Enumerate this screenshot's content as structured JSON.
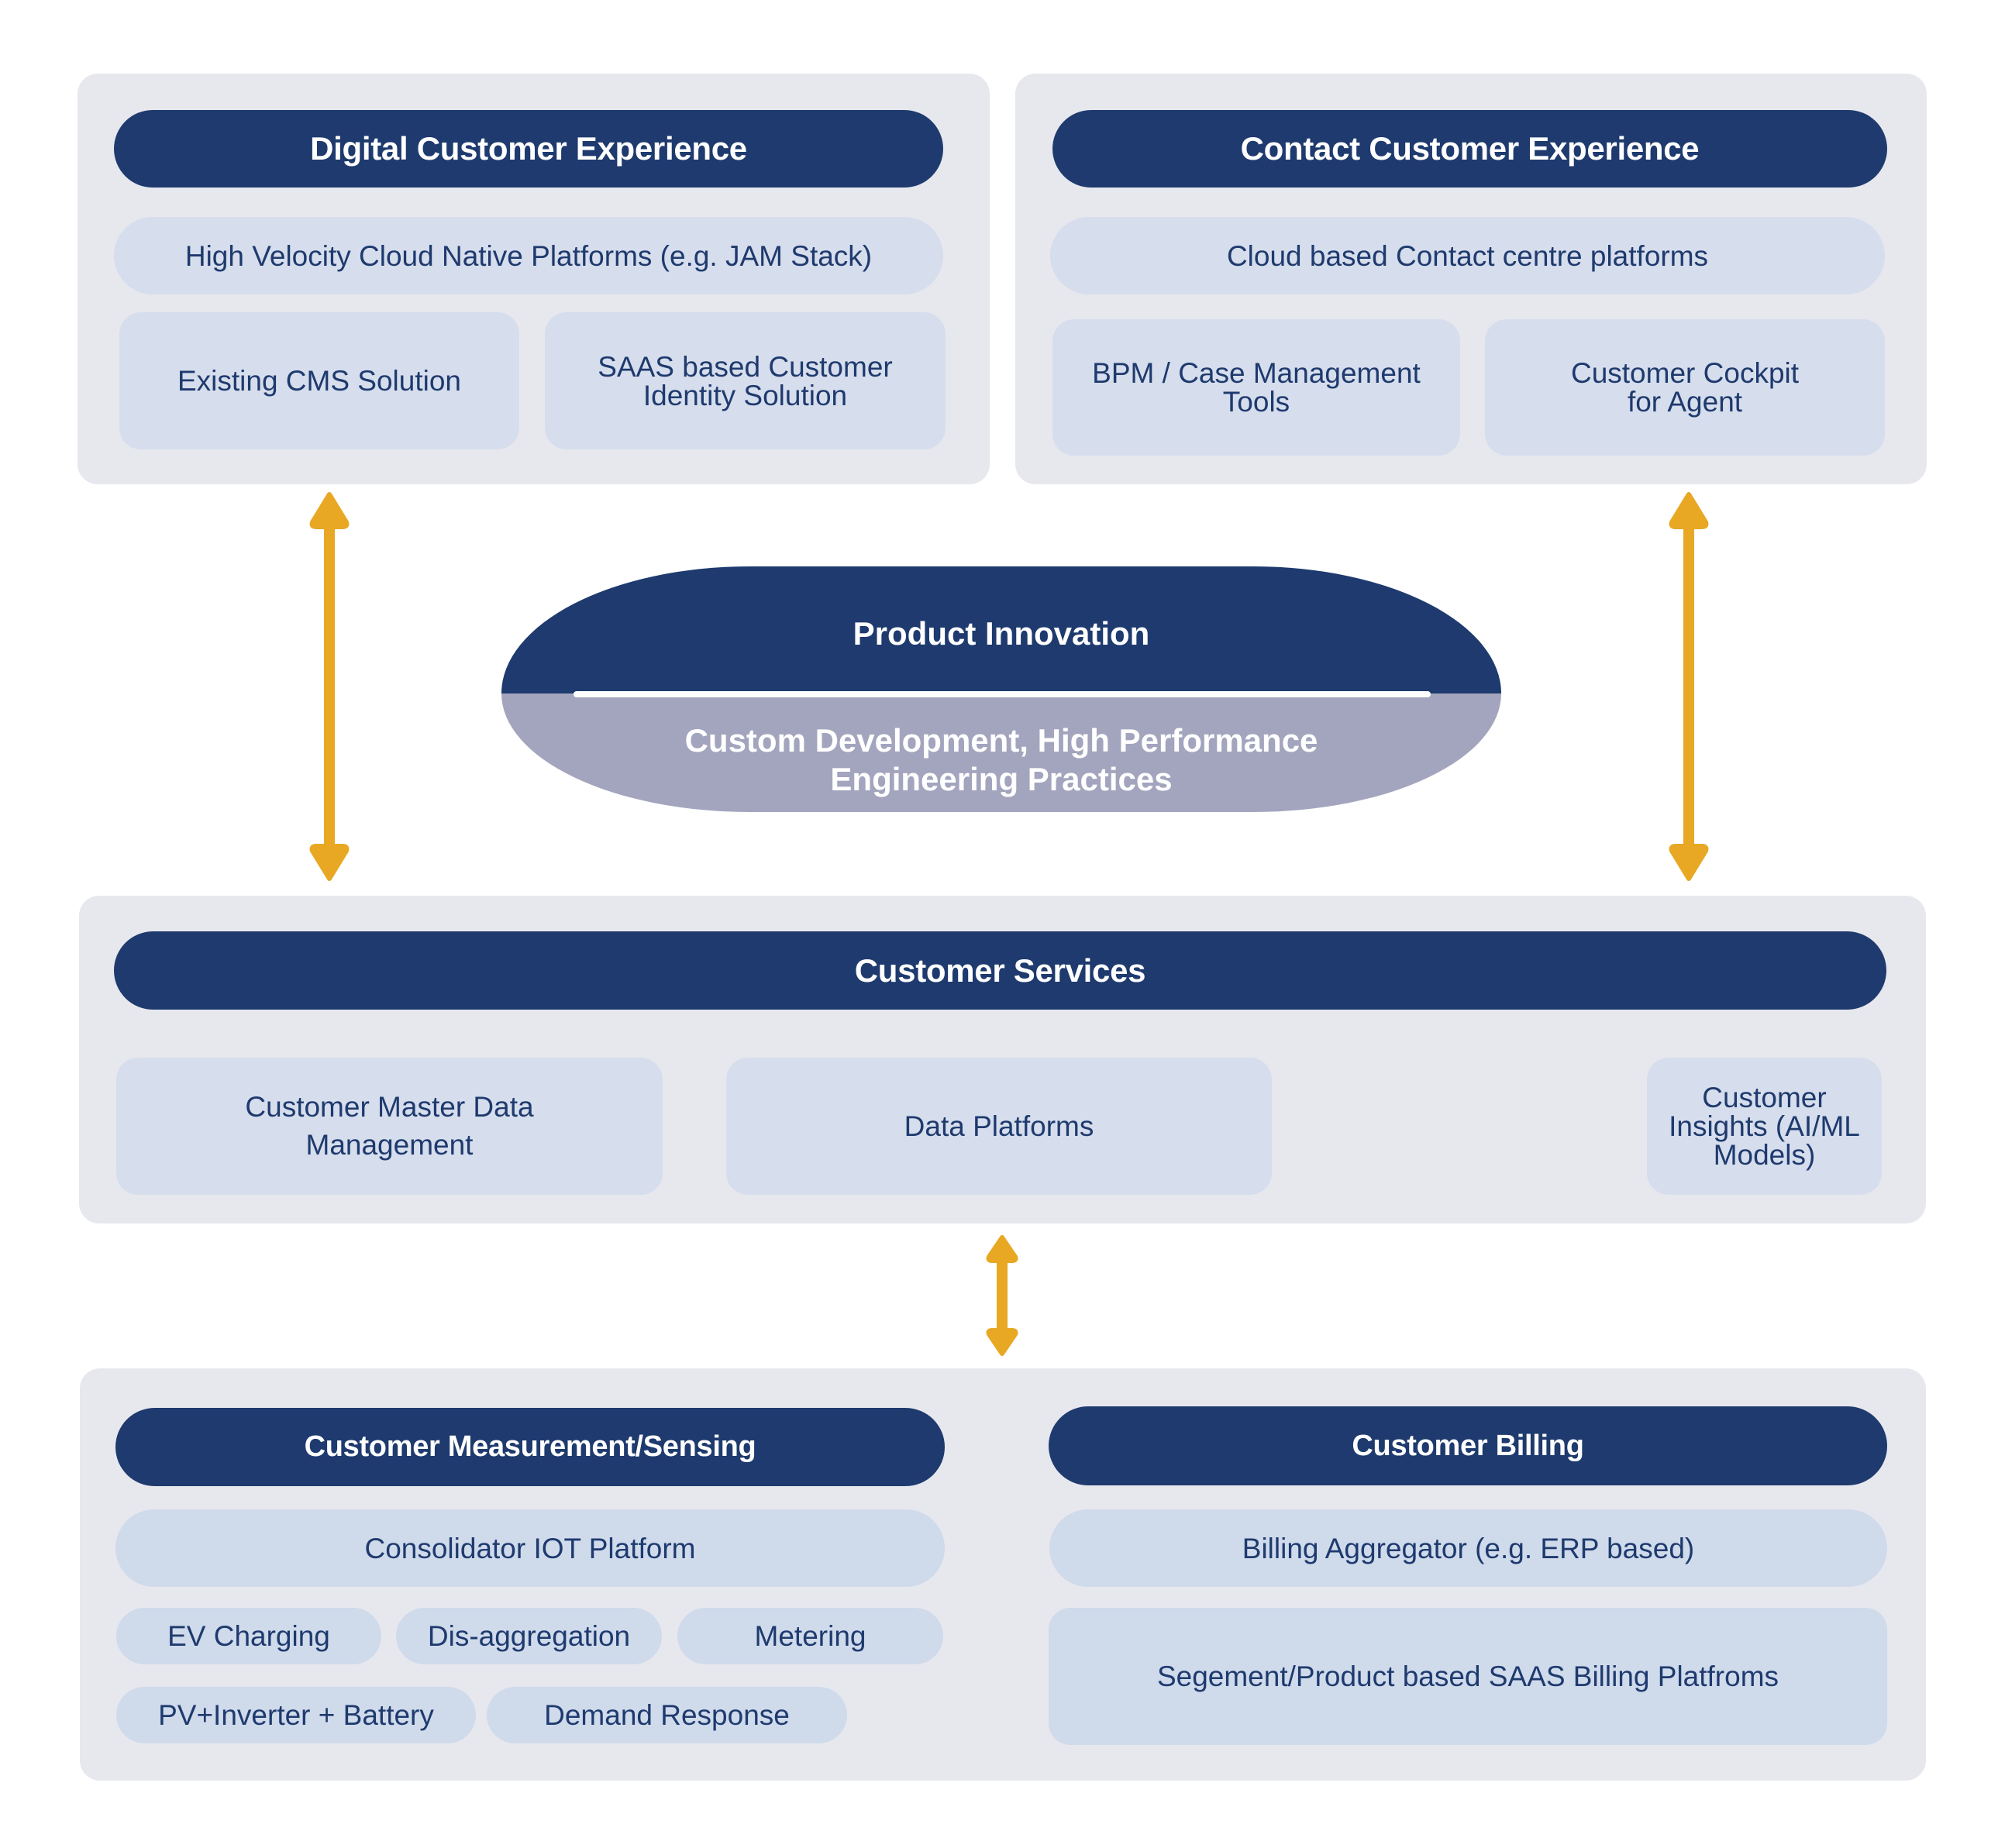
{
  "colors": {
    "header_navy": "#1e3a6e",
    "panel_bg": "#e7e8ee",
    "sub_box": "#d6ddec",
    "sub_box_alt": "#cfdaeb",
    "innovation_bottom": "#a3a5be",
    "arrow": "#e8a823"
  },
  "digital_cx": {
    "title": "Digital Customer Experience",
    "platform": "High Velocity Cloud Native Platforms (e.g. JAM Stack)",
    "items": [
      "Existing CMS Solution",
      "SAAS based Customer\nIdentity Solution"
    ]
  },
  "contact_cx": {
    "title": "Contact Customer Experience",
    "platform": "Cloud based Contact centre platforms",
    "items": [
      "BPM / Case Management\nTools",
      "Customer Cockpit\nfor Agent"
    ]
  },
  "innovation": {
    "title": "Product Innovation",
    "subtitle_line1": "Custom Development, High Performance",
    "subtitle_line2": "Engineering Practices"
  },
  "customer_services": {
    "title": "Customer Services",
    "items": [
      "Customer Master Data\nManagement",
      "Data Platforms",
      "Customer Insights (AI/ML Models)"
    ]
  },
  "measurement": {
    "title": "Customer Measurement/Sensing",
    "platform": "Consolidator IOT Platform",
    "chips": [
      "EV Charging",
      "Dis-aggregation",
      "Metering",
      "PV+Inverter + Battery",
      "Demand Response"
    ]
  },
  "billing": {
    "title": "Customer Billing",
    "platform": "Billing Aggregator (e.g. ERP based)",
    "item": "Segement/Product based SAAS Billing Platfroms"
  },
  "connectors": [
    {
      "name": "digital-cx-to-services",
      "type": "bidirectional-arrow"
    },
    {
      "name": "contact-cx-to-services",
      "type": "bidirectional-arrow"
    },
    {
      "name": "services-to-operations",
      "type": "bidirectional-arrow"
    }
  ]
}
